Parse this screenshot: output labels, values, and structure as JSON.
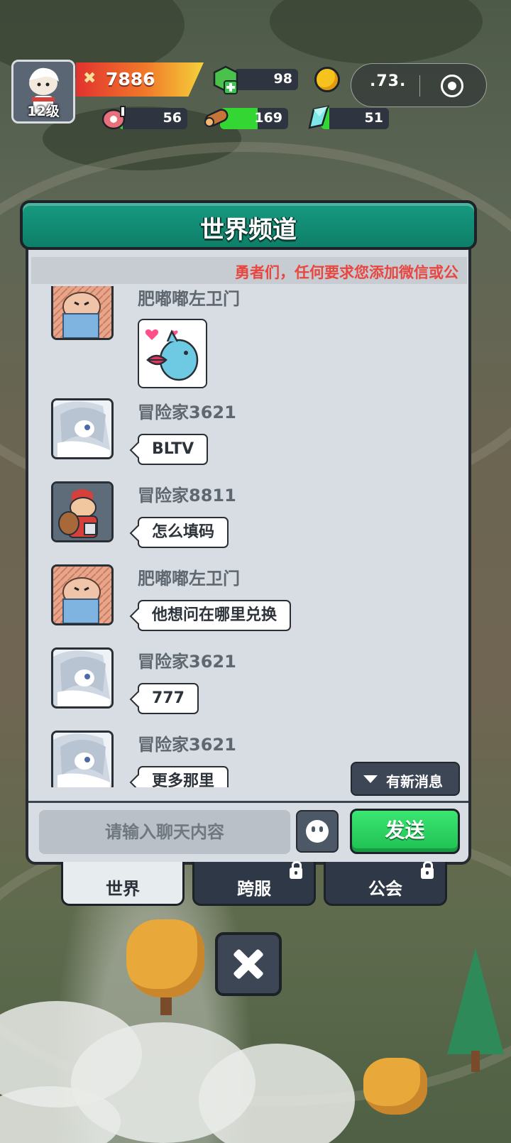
{
  "hud": {
    "level": "12级",
    "power": "7886",
    "gems": "98",
    "coins_more": ".73.",
    "meat": "56",
    "wood": "169",
    "crystal": "51",
    "meat_fill": 0.05,
    "wood_fill": 0.55,
    "crystal_fill": 0.12
  },
  "panel": {
    "title": "世界频道",
    "notice": "勇者们，任何要求您添加微信或公"
  },
  "messages": [
    {
      "name": "肥嘟嘟左卫门",
      "type": "sticker",
      "text": ""
    },
    {
      "name": "冒险家3621",
      "type": "text",
      "text": "BLTV"
    },
    {
      "name": "冒险家8811",
      "type": "text",
      "text": "怎么填码"
    },
    {
      "name": "肥嘟嘟左卫门",
      "type": "text",
      "text": "他想问在哪里兑换"
    },
    {
      "name": "冒险家3621",
      "type": "text",
      "text": "777"
    },
    {
      "name": "冒险家3621",
      "type": "text",
      "text": "更多那里"
    }
  ],
  "new_message_label": "有新消息",
  "input": {
    "placeholder": "请输入聊天内容",
    "send_label": "发送"
  },
  "tabs": [
    {
      "label": "世界",
      "active": true,
      "locked": false
    },
    {
      "label": "跨服",
      "active": false,
      "locked": true
    },
    {
      "label": "公会",
      "active": false,
      "locked": true
    }
  ],
  "colors": {
    "header": "#129078",
    "send": "#2fd563",
    "notice": "#e8463f",
    "panel": "#d7dde2"
  }
}
